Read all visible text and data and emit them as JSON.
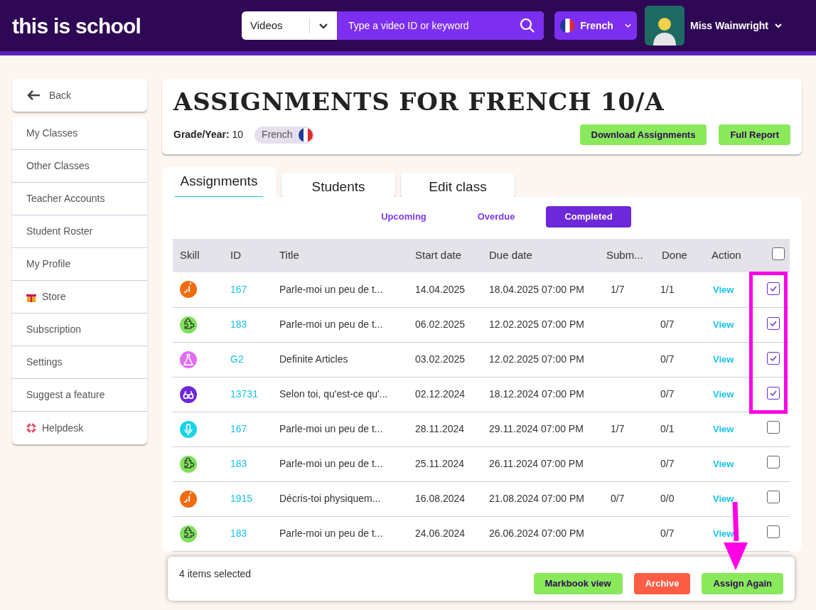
{
  "header": {
    "logo": "this is school",
    "search": {
      "category": "Videos",
      "placeholder": "Type a video ID or keyword"
    },
    "language": "French",
    "user": "Miss Wainwright"
  },
  "sidebar": {
    "back": "Back",
    "items": [
      {
        "label": "My Classes",
        "kind": "plain"
      },
      {
        "label": "Other Classes",
        "kind": "plain"
      },
      {
        "label": "Teacher Accounts",
        "kind": "plain"
      },
      {
        "label": "Student Roster",
        "kind": "plain"
      },
      {
        "label": "My Profile",
        "kind": "plain"
      },
      {
        "label": "Store",
        "kind": "gift"
      },
      {
        "label": "Subscription",
        "kind": "plain"
      },
      {
        "label": "Settings",
        "kind": "plain"
      },
      {
        "label": "Suggest a feature",
        "kind": "plain"
      },
      {
        "label": "Helpdesk",
        "kind": "help"
      }
    ]
  },
  "class_card": {
    "title": "ASSIGNMENTS FOR FRENCH 10/A",
    "grade_label": "Grade/Year:",
    "grade": "10",
    "language_tag": "French",
    "buttons": [
      "Download Assignments",
      "Full Report"
    ]
  },
  "tabs": [
    {
      "label": "Assignments",
      "selected": true
    },
    {
      "label": "Students",
      "selected": false
    },
    {
      "label": "Edit class",
      "selected": false
    }
  ],
  "filters": [
    {
      "label": "Upcoming",
      "selected": false
    },
    {
      "label": "Overdue",
      "selected": false
    },
    {
      "label": "Completed",
      "selected": true
    }
  ],
  "table": {
    "columns": [
      "Skill",
      "ID",
      "Title",
      "Start date",
      "Due date",
      "Subm...",
      "Done",
      "Action"
    ],
    "select_all": {
      "checked": false
    },
    "rows": [
      {
        "kind": "writing",
        "color": "#f26b0f",
        "id": "167",
        "title": "Parle-moi un peu de t...",
        "start": "14.04.2025",
        "due": "18.04.2025 07:00 PM",
        "submitted": "1/7",
        "done": "1/1",
        "action": "View",
        "checked": true
      },
      {
        "kind": "puzzle",
        "color": "#7ee05a",
        "id": "183",
        "title": "Parle-moi un peu de t...",
        "start": "06.02.2025",
        "due": "12.02.2025 07:00 PM",
        "submitted": "",
        "done": "0/7",
        "action": "View",
        "checked": true
      },
      {
        "kind": "flask",
        "color": "#e36ef5",
        "id": "G2",
        "title": "Definite Articles",
        "start": "03.02.2025",
        "due": "12.02.2025 07:00 PM",
        "submitted": "",
        "done": "0/7",
        "action": "View",
        "checked": true
      },
      {
        "kind": "reading",
        "color": "#6d28d9",
        "id": "13731",
        "title": "Selon toi, qu'est-ce qu'...",
        "start": "02.12.2024",
        "due": "18.12.2024 07:00 PM",
        "submitted": "",
        "done": "0/7",
        "action": "View",
        "checked": true
      },
      {
        "kind": "speaking",
        "color": "#19d3e8",
        "id": "167",
        "title": "Parle-moi un peu de t...",
        "start": "28.11.2024",
        "due": "29.11.2024 07:00 PM",
        "submitted": "1/7",
        "done": "0/1",
        "action": "View",
        "checked": false
      },
      {
        "kind": "puzzle",
        "color": "#7ee05a",
        "id": "183",
        "title": "Parle-moi un peu de t...",
        "start": "25.11.2024",
        "due": "26.11.2024 07:00 PM",
        "submitted": "",
        "done": "0/7",
        "action": "View",
        "checked": false
      },
      {
        "kind": "writing",
        "color": "#f26b0f",
        "id": "1915",
        "title": "Décris-toi physiquem...",
        "start": "16.08.2024",
        "due": "21.08.2024 07:00 PM",
        "submitted": "0/7",
        "done": "0/0",
        "action": "View",
        "checked": false
      },
      {
        "kind": "puzzle",
        "color": "#7ee05a",
        "id": "183",
        "title": "Parle-moi un peu de t...",
        "start": "24.06.2024",
        "due": "26.06.2024 07:00 PM",
        "submitted": "",
        "done": "0/7",
        "action": "View",
        "checked": false
      }
    ]
  },
  "selection_bar": {
    "count": "4 items selected",
    "buttons": [
      {
        "label": "Markbook view",
        "kind": "green"
      },
      {
        "label": "Archive",
        "kind": "red"
      },
      {
        "label": "Assign Again",
        "kind": "green"
      }
    ]
  },
  "annotations": {
    "highlight_frame": true,
    "pointer_arrow": true
  }
}
